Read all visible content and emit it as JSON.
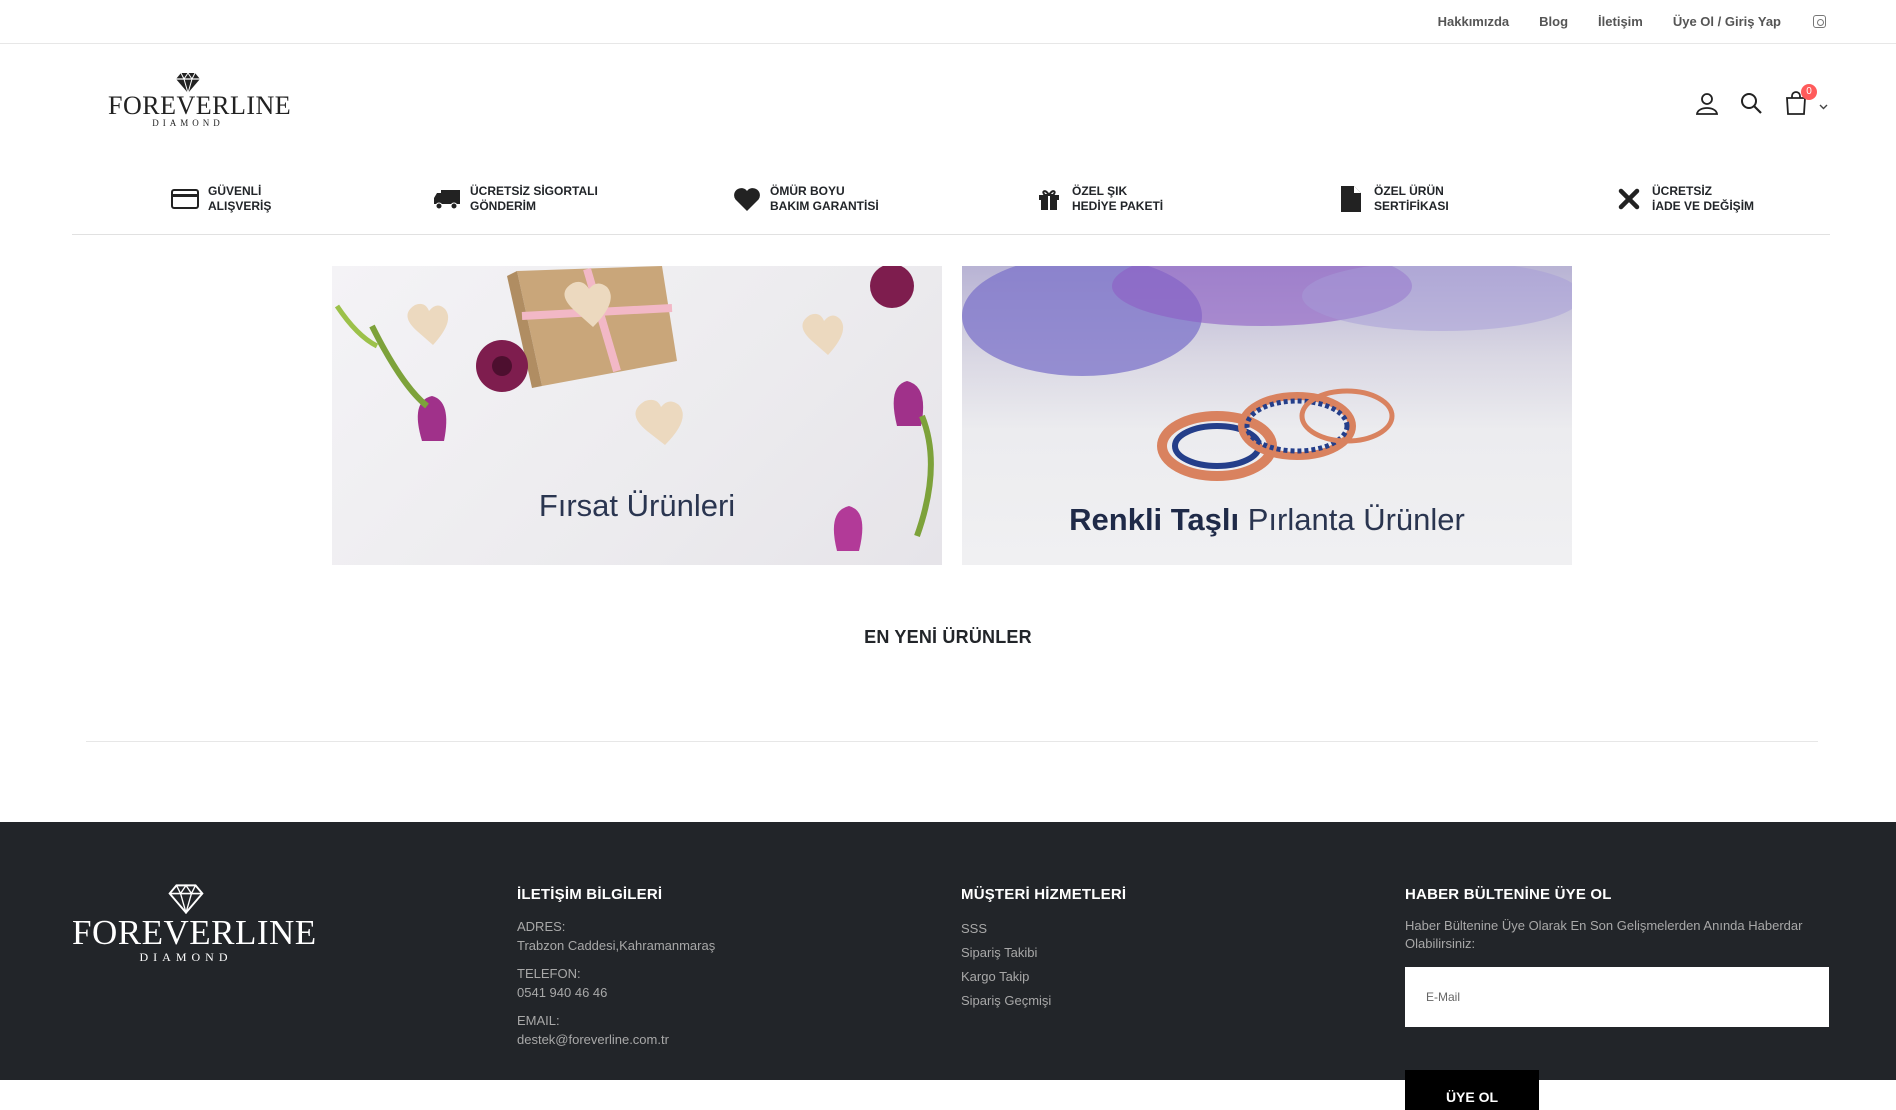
{
  "topbar": {
    "links": [
      "Hakkımızda",
      "Blog",
      "İletişim",
      "Üye Ol / Giriş Yap"
    ],
    "social_icon": "instagram-icon"
  },
  "header": {
    "logo_text": "FOREVERLINE",
    "logo_sub": "DIAMOND",
    "icons": [
      "user-icon",
      "search-icon",
      "cart-icon"
    ],
    "cart_count": "0"
  },
  "features": [
    {
      "icon": "credit-card-icon",
      "line1": "GÜVENLİ",
      "line2": "ALIŞVERİŞ"
    },
    {
      "icon": "truck-icon",
      "line1": "ÜCRETSİZ SİGORTALI",
      "line2": "GÖNDERİM"
    },
    {
      "icon": "heart-icon",
      "line1": "ÖMÜR BOYU",
      "line2": "BAKIM GARANTİSİ"
    },
    {
      "icon": "gift-icon",
      "line1": "ÖZEL ŞIK",
      "line2": "HEDİYE PAKETİ"
    },
    {
      "icon": "file-icon",
      "line1": "ÖZEL ÜRÜN",
      "line2": "SERTİFİKASI"
    },
    {
      "icon": "close-icon",
      "line1": "ÜCRETSİZ",
      "line2": "İADE VE DEĞİŞİM"
    }
  ],
  "banners": {
    "left": {
      "title": "Fırsat Ürünleri"
    },
    "right": {
      "title_bold": "Renkli Taşlı",
      "title_rest": " Pırlanta Ürünler"
    }
  },
  "section": {
    "title": "EN YENİ ÜRÜNLER"
  },
  "footer": {
    "logo_text": "FOREVERLINE",
    "logo_sub": "DIAMOND",
    "contact": {
      "heading": "İLETİŞİM BİLGİLERİ",
      "address_label": "ADRES:",
      "address": "Trabzon Caddesi,Kahramanmaraş",
      "phone_label": "TELEFON:",
      "phone": "0541 940 46 46",
      "email_label": "EMAIL:",
      "email": "destek@foreverline.com.tr"
    },
    "service": {
      "heading": "MÜŞTERİ HİZMETLERİ",
      "links": [
        "SSS",
        "Sipariş Takibi",
        "Kargo Takip",
        "Sipariş Geçmişi"
      ]
    },
    "newsletter": {
      "heading": "HABER BÜLTENİNE ÜYE OL",
      "text": "Haber Bültenine Üye Olarak En Son Gelişmelerden Anında Haberdar Olabilirsiniz:",
      "placeholder": "E-Mail",
      "button": "ÜYE OL"
    }
  },
  "colors": {
    "footer_bg": "#222529",
    "cart_badge": "#ff5b5b",
    "banner_title": "#2a3550"
  }
}
